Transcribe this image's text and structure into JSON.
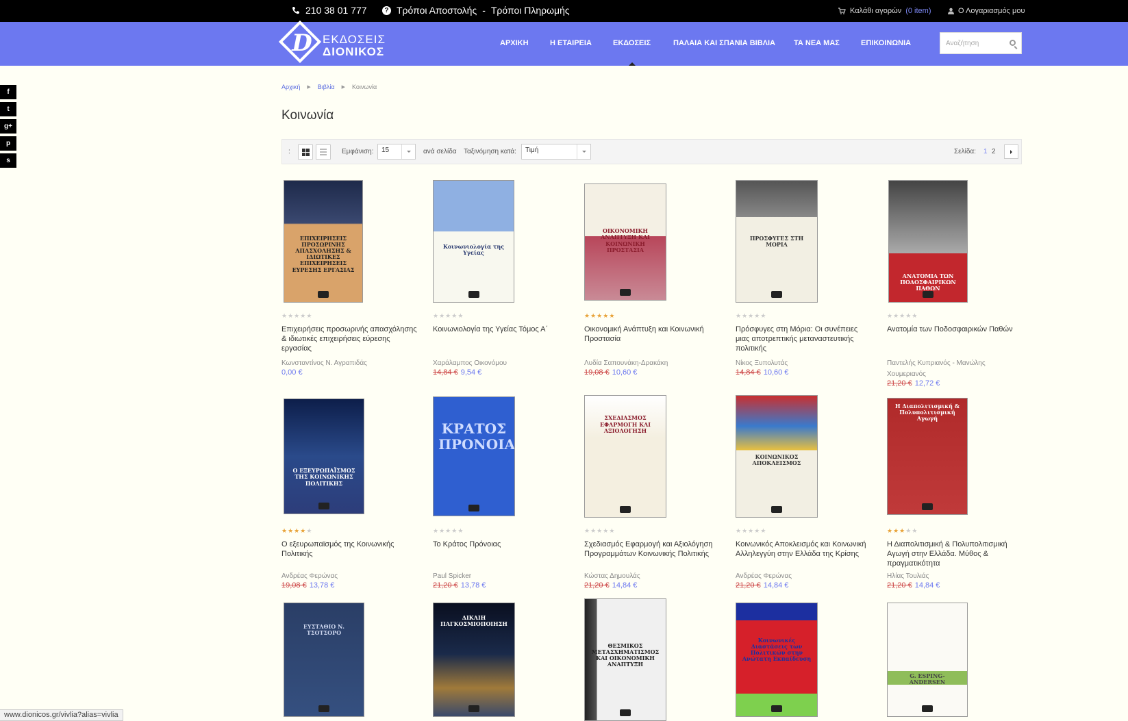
{
  "topbar": {
    "phone": "210 38 01 777",
    "shipping": "Τρόποι Αποστολής",
    "dash": "-",
    "payment": "Τρόποι Πληρωμής",
    "cart_label": "Καλάθι αγορών",
    "cart_count": "(0 item)",
    "account": "Ο Λογαριασμός μου"
  },
  "logo": {
    "line1": "ΕΚΔΟΣΕΙΣ",
    "line2": "ΔΙΟΝΙΚΟΣ"
  },
  "nav": [
    "ΑΡΧΙΚΗ",
    "Η ΕΤΑΙΡΕΙΑ",
    "ΕΚΔΟΣΕΙΣ",
    "ΠΑΛΑΙΑ ΚΑΙ ΣΠΑΝΙΑ ΒΙΒΛΙΑ",
    "ΤΑ ΝΕΑ ΜΑΣ",
    "ΕΠΙΚΟΙΝΩΝΙΑ"
  ],
  "search": {
    "placeholder": "Αναζήτηση"
  },
  "social": [
    "f",
    "t",
    "g+",
    "p",
    "s"
  ],
  "breadcrumb": [
    "Αρχική",
    "Βιβλία",
    "Κοινωνία"
  ],
  "page_title": "Κοινωνία",
  "toolbar": {
    "colon": ":",
    "show_label": "Εμφάνιση:",
    "show_value": "15",
    "per_page": "ανά σελίδα",
    "sort_label": "Ταξινόμηση κατά:",
    "sort_value": "Τιμή",
    "page_label": "Σελίδα:",
    "pages": [
      "1",
      "2"
    ]
  },
  "products": [
    {
      "name": "Επιχειρήσεις προσωρινής απασχόλησης & ιδιωτικές επιχειρήσεις εύρεσης εργασίας",
      "author": "Κωνσταντίνος Ν. Αγραπιδάς",
      "old_price": "",
      "price": "0,00 €",
      "rating": 0,
      "cover_title": "ΕΠΙΧΕΙΡΗΣΕΙΣ ΠΡΟΣΩΡΙΝΗΣ ΑΠΑΣΧΟΛΗΣΗΣ & ΙΔΙΩΤΙΚΕΣ ΕΠΙΧΕΙΡΗΣΕΙΣ ΕΥΡΕΣΗΣ ΕΡΓΑΣΙΑΣ"
    },
    {
      "name": "Κοινωνιολογία της Υγείας Τόμος Α΄",
      "author": "Χαράλαμπος Οικονόμου",
      "old_price": "14,84 €",
      "price": "9,54 €",
      "rating": 0,
      "cover_title": "Κοινωνιολογία της Υγείας"
    },
    {
      "name": "Οικονομική Ανάπτυξη και Κοινωνική Προστασία",
      "author": "Λυδία Σαπουνάκη-Δρακάκη",
      "old_price": "19,08 €",
      "price": "10,60 €",
      "rating": 5,
      "cover_title": "ΟΙΚΟΝΟΜΙΚΗ ΑΝΑΠΤΥΞΗ ΚΑΙ ΚΟΙΝΩΝΙΚΗ ΠΡΟΣΤΑΣΙΑ"
    },
    {
      "name": "Πρόσφυγες στη Μόρια: Οι συνέπειες μιας αποτρεπτικής μεταναστευτικής πολιτικής",
      "author": "Νίκος Ξυπολυτάς",
      "old_price": "14,84 €",
      "price": "10,60 €",
      "rating": 0,
      "cover_title": "ΠΡΟΣΦΥΓΕΣ ΣΤΗ ΜΟΡΙΑ"
    },
    {
      "name": "Ανατομία των Ποδοσφαιρικών Παθών",
      "author": "Παντελής Κυπριανός - Μανώλης Χουμεριανός",
      "old_price": "21,20 €",
      "price": "12,72 €",
      "rating": 0,
      "cover_title": "ΑΝΑΤΟΜΙΑ ΤΩΝ ΠΟΔΟΣΦΑΙΡΙΚΩΝ ΠΑΘΩΝ"
    },
    {
      "name": "Ο εξευρωπαϊσμός της Κοινωνικής Πολιτικής",
      "author": "Ανδρέας Φερώνας",
      "old_price": "19,08 €",
      "price": "13,78 €",
      "rating": 4,
      "cover_title": "Ο ΕΞΕΥΡΩΠΑΪΣΜΟΣ ΤΗΣ ΚΟΙΝΩΝΙΚΗΣ ΠΟΛΙΤΙΚΗΣ"
    },
    {
      "name": "Το Κράτος Πρόνοιας",
      "author": "Paul Spicker",
      "old_price": "21,20 €",
      "price": "13,78 €",
      "rating": 0,
      "cover_title": "ΚΡΑΤΟΣ ΠΡΟΝΟΙΑΣ"
    },
    {
      "name": "Σχεδιασμός Εφαρμογή και Αξιολόγηση Προγραμμάτων Κοινωνικής Πολιτικής",
      "author": "Κώστας Δημουλάς",
      "old_price": "21,20 €",
      "price": "14,84 €",
      "rating": 0,
      "cover_title": "ΣΧΕΔΙΑΣΜΟΣ ΕΦΑΡΜΟΓΗ ΚΑΙ ΑΞΙΟΛΟΓΗΣΗ"
    },
    {
      "name": "Κοινωνικός Αποκλεισμός και Κοινωνική Αλληλεγγύη στην Ελλάδα της Κρίσης",
      "author": "Ανδρέας Φερώνας",
      "old_price": "21,20 €",
      "price": "14,84 €",
      "rating": 0,
      "cover_title": "ΚΟΙΝΩΝΙΚΟΣ ΑΠΟΚΛΕΙΣΜΟΣ"
    },
    {
      "name": "Η Διαπολιτισμική & Πολυπολιτισμική Αγωγή στην Ελλάδα. Μύθος & πραγματικότητα",
      "author": "Ηλίας Τουλιάς",
      "old_price": "21,20 €",
      "price": "14,84 €",
      "rating": 3,
      "cover_title": "Η Διαπολιτισμική & Πολυπολιτισμική Αγωγή"
    },
    {
      "name": "",
      "author": "",
      "old_price": "",
      "price": "",
      "rating": 0,
      "cover_title": "ΕΥΣΤΑΘΙΟ Ν. ΤΣΟΤΣΟΡΟ"
    },
    {
      "name": "",
      "author": "",
      "old_price": "",
      "price": "",
      "rating": 0,
      "cover_title": "ΔΙΚΑΙΗ ΠΑΓΚΟΣΜΙΟΠΟΙΗΣΗ"
    },
    {
      "name": "",
      "author": "",
      "old_price": "",
      "price": "",
      "rating": 0,
      "cover_title": "ΘΕΣΜΙΚΟΣ ΜΕΤΑΣΧΗΜΑΤΙΣΜΟΣ ΚΑΙ ΟΙΚΟΝΟΜΙΚΗ ΑΝΑΠΤΥΞΗ"
    },
    {
      "name": "",
      "author": "",
      "old_price": "",
      "price": "",
      "rating": 0,
      "cover_title": "Κοινωνικές Διαστάσεις των Πολιτικών στην Ανώτατη Εκπαίδευση"
    },
    {
      "name": "",
      "author": "",
      "old_price": "",
      "price": "",
      "rating": 0,
      "cover_title": "G. ESPING-ANDERSEN"
    }
  ],
  "status_url": "www.dionicos.gr/vivlia?alias=vivlia",
  "colors": {
    "brand": "#6c78f0",
    "link": "#5a6be0",
    "star": "#e8a33a",
    "old_price": "#cc4444"
  }
}
